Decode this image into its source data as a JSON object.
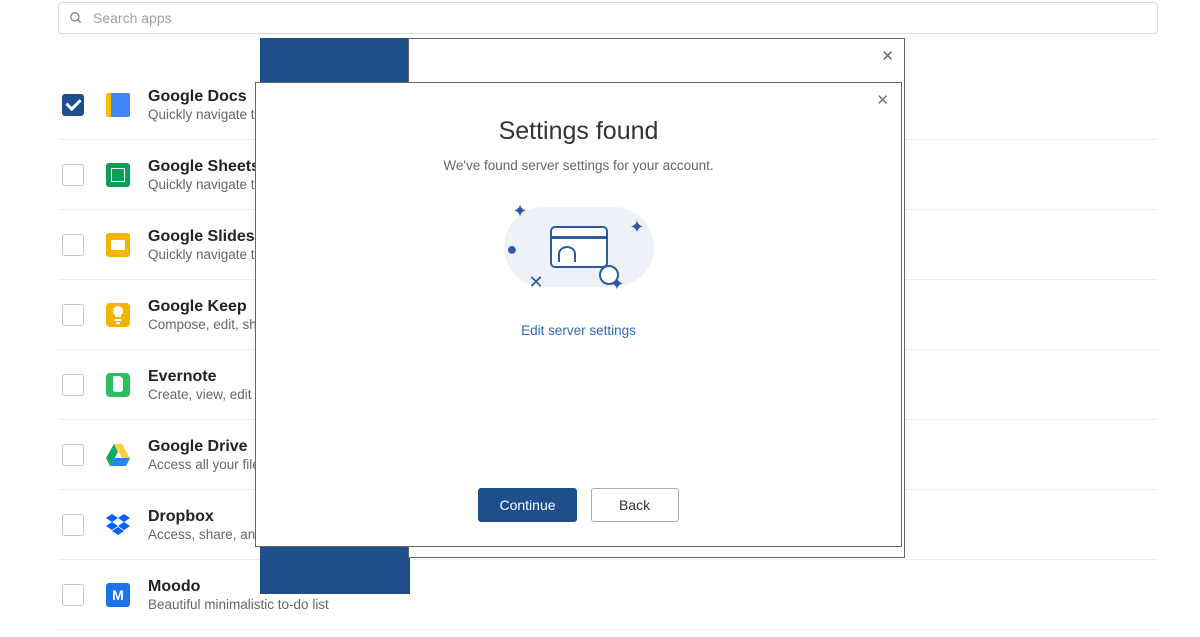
{
  "search": {
    "placeholder": "Search apps"
  },
  "apps": [
    {
      "name": "Google Docs",
      "desc": "Quickly navigate to your documents",
      "checked": true,
      "iconClass": "ic-docs"
    },
    {
      "name": "Google Sheets",
      "desc": "Quickly navigate to your spreadsheets",
      "checked": false,
      "iconClass": "ic-sheets"
    },
    {
      "name": "Google Slides",
      "desc": "Quickly navigate to your presentations",
      "checked": false,
      "iconClass": "ic-slides"
    },
    {
      "name": "Google Keep",
      "desc": "Compose, edit, share notes",
      "checked": false,
      "iconClass": "ic-keep"
    },
    {
      "name": "Evernote",
      "desc": "Create, view, edit notes",
      "checked": false,
      "iconClass": "ic-evernote"
    },
    {
      "name": "Google Drive",
      "desc": "Access all your files in one place",
      "checked": false,
      "iconClass": "ic-drive"
    },
    {
      "name": "Dropbox",
      "desc": "Access, share, and organize files",
      "checked": false,
      "iconClass": "ic-dropbox"
    },
    {
      "name": "Moodo",
      "desc": "Beautiful minimalistic to-do list",
      "checked": false,
      "iconClass": "ic-moodo"
    }
  ],
  "modal": {
    "title": "Settings found",
    "subtitle": "We've found server settings for your account.",
    "edit_link": "Edit server settings",
    "continue": "Continue",
    "back": "Back"
  }
}
